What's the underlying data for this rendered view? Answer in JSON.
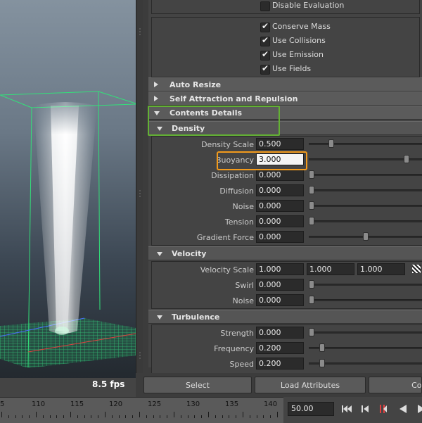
{
  "viewport": {
    "fps": "8.5 fps"
  },
  "attribute_editor": {
    "disable_evaluation": {
      "label": "Disable Evaluation",
      "checked": false
    },
    "checkboxes": [
      {
        "label": "Conserve Mass",
        "checked": true
      },
      {
        "label": "Use Collisions",
        "checked": true
      },
      {
        "label": "Use Emission",
        "checked": true
      },
      {
        "label": "Use Fields",
        "checked": true
      }
    ],
    "sections": {
      "auto_resize": "Auto Resize",
      "self_attraction": "Self Attraction and Repulsion",
      "contents_details": "Contents Details",
      "density": "Density",
      "velocity": "Velocity",
      "turbulence": "Turbulence"
    },
    "density": [
      {
        "label": "Density Scale",
        "value": "0.500",
        "slider": 0.18
      },
      {
        "label": "Buoyancy",
        "value": "3.000",
        "slider": 0.88
      },
      {
        "label": "Dissipation",
        "value": "0.000",
        "slider": 0.0
      },
      {
        "label": "Diffusion",
        "value": "0.000",
        "slider": 0.0
      },
      {
        "label": "Noise",
        "value": "0.000",
        "slider": 0.0
      },
      {
        "label": "Tension",
        "value": "0.000",
        "slider": 0.0
      },
      {
        "label": "Gradient Force",
        "value": "0.000",
        "slider": 0.5
      }
    ],
    "velocity": {
      "scale": {
        "label": "Velocity Scale",
        "x": "1.000",
        "y": "1.000",
        "z": "1.000"
      },
      "rows": [
        {
          "label": "Swirl",
          "value": "0.000",
          "slider": 0.0
        },
        {
          "label": "Noise",
          "value": "0.000",
          "slider": 0.0
        }
      ]
    },
    "turbulence": [
      {
        "label": "Strength",
        "value": "0.000",
        "slider": 0.0
      },
      {
        "label": "Frequency",
        "value": "0.200",
        "slider": 0.1
      },
      {
        "label": "Speed",
        "value": "0.200",
        "slider": 0.1
      }
    ]
  },
  "buttons": {
    "select": "Select",
    "load": "Load Attributes",
    "copy": "Copy"
  },
  "timeline": {
    "labels": [
      "5",
      "110",
      "115",
      "120",
      "125",
      "130",
      "135",
      "140"
    ],
    "current_frame": "50.00"
  }
}
